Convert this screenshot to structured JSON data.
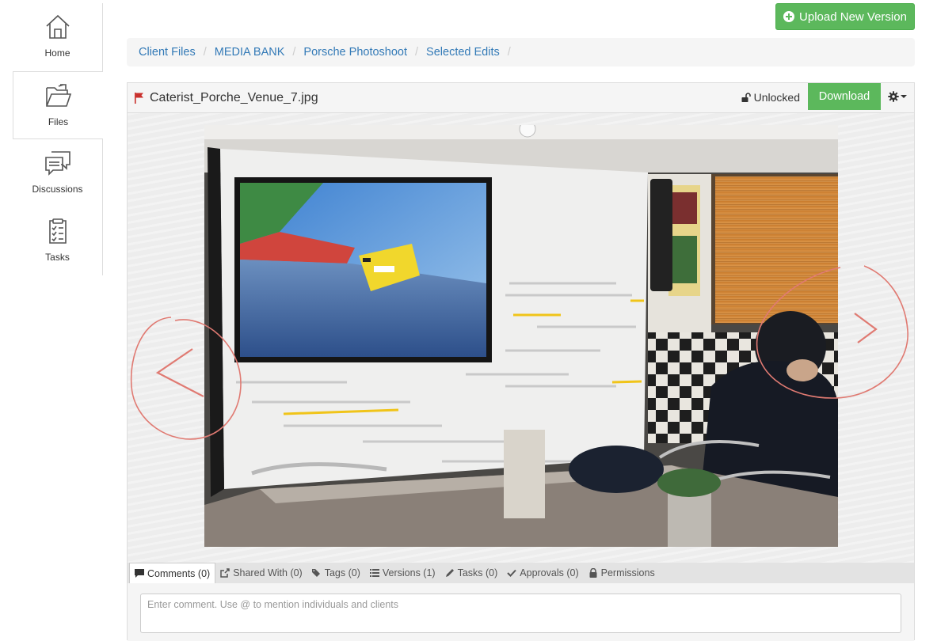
{
  "sidebar": {
    "items": [
      {
        "label": "Home",
        "icon": "home-icon"
      },
      {
        "label": "Files",
        "icon": "folder-open-icon"
      },
      {
        "label": "Discussions",
        "icon": "chat-icon"
      },
      {
        "label": "Tasks",
        "icon": "clipboard-icon"
      }
    ]
  },
  "toolbar": {
    "upload_label": "Upload New Version"
  },
  "breadcrumb": [
    "Client Files",
    "MEDIA BANK",
    "Porsche Photoshoot",
    "Selected Edits"
  ],
  "file": {
    "name": "Caterist_Porche_Venue_7.jpg",
    "lock_status": "Unlocked",
    "download_label": "Download"
  },
  "tabs": [
    {
      "label": "Comments (0)",
      "icon": "comment-icon"
    },
    {
      "label": "Shared With (0)",
      "icon": "share-icon"
    },
    {
      "label": "Tags (0)",
      "icon": "tags-icon"
    },
    {
      "label": "Versions (1)",
      "icon": "list-icon"
    },
    {
      "label": "Tasks (0)",
      "icon": "pencil-icon"
    },
    {
      "label": "Approvals (0)",
      "icon": "check-icon"
    },
    {
      "label": "Permissions",
      "icon": "lock-icon"
    }
  ],
  "comment": {
    "placeholder": "Enter comment. Use @ to mention individuals and clients"
  },
  "colors": {
    "accent_green": "#5cb85c",
    "link_blue": "#337ab7",
    "flag_red": "#c9302c",
    "annotation_red": "#e07a72"
  }
}
